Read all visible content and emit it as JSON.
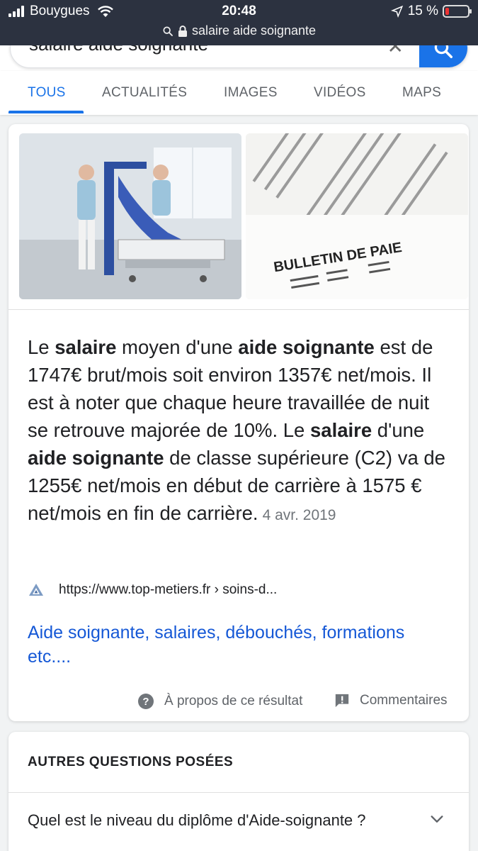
{
  "status_bar": {
    "carrier": "Bouygues",
    "time": "20:48",
    "battery_text": "15 %",
    "battery_level": 0.15,
    "url": "salaire aide soignante"
  },
  "search": {
    "query": "salaire aide soignante"
  },
  "tabs": [
    {
      "label": "TOUS",
      "active": true
    },
    {
      "label": "ACTUALITÉS",
      "active": false
    },
    {
      "label": "IMAGES",
      "active": false
    },
    {
      "label": "VIDÉOS",
      "active": false
    },
    {
      "label": "MAPS",
      "active": false
    }
  ],
  "featured_snippet": {
    "image2_caption": "BULLETIN DE PAIE",
    "text_parts": [
      {
        "t": "Le ",
        "b": false
      },
      {
        "t": "salaire",
        "b": true
      },
      {
        "t": " moyen d'une ",
        "b": false
      },
      {
        "t": "aide soignante",
        "b": true
      },
      {
        "t": " est de 1747€ brut/mois soit environ 1357€ net/mois. Il est à noter que chaque heure travaillée de nuit se retrouve majorée de 10%. Le ",
        "b": false
      },
      {
        "t": "salaire",
        "b": true
      },
      {
        "t": " d'une ",
        "b": false
      },
      {
        "t": "aide soignante",
        "b": true
      },
      {
        "t": " de classe supérieure (C2) va de 1255€ net/mois en début de carrière à 1575 € net/mois en fin de carrière.",
        "b": false
      }
    ],
    "date": "4 avr. 2019",
    "source_url": "https://www.top-metiers.fr › soins-d...",
    "link_title": "Aide soignante, salaires, débouchés, formations etc....",
    "about_label": "À propos de ce résultat",
    "feedback_label": "Commentaires"
  },
  "people_also_ask": {
    "title": "AUTRES QUESTIONS POSÉES",
    "questions": [
      "Quel est le niveau du diplôme d'Aide-soignante ?"
    ]
  }
}
